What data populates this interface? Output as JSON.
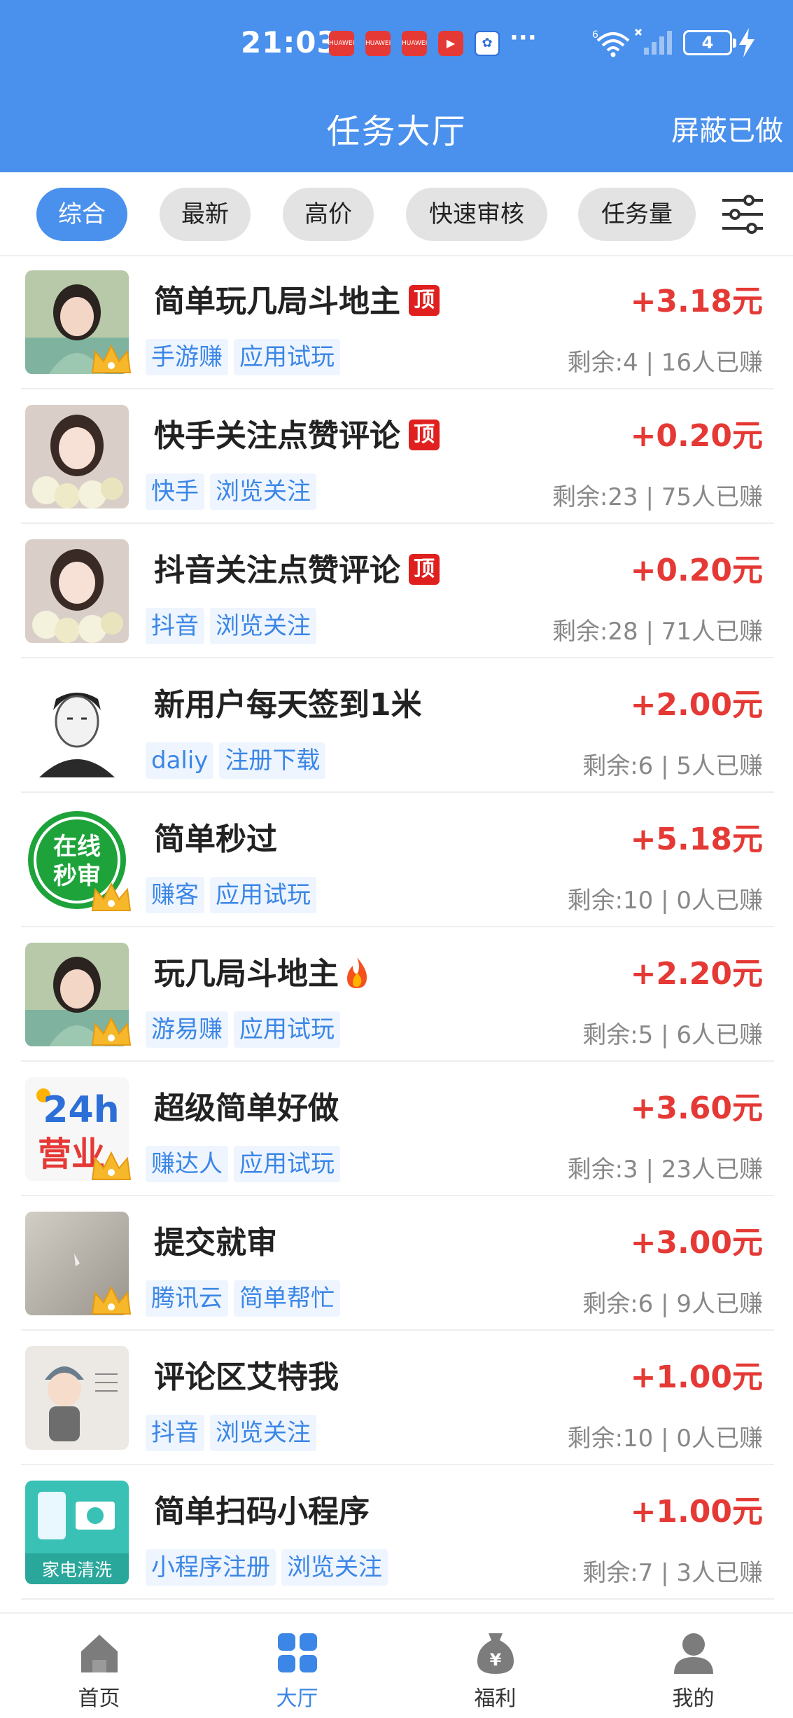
{
  "status_bar": {
    "time": "21:03",
    "network": "6",
    "battery": "4",
    "more": "···"
  },
  "header": {
    "title": "任务大厅",
    "hide_done": "屏蔽已做"
  },
  "filters": [
    {
      "label": "综合",
      "active": true
    },
    {
      "label": "最新",
      "active": false
    },
    {
      "label": "高价",
      "active": false
    },
    {
      "label": "快速审核",
      "active": false
    },
    {
      "label": "任务量",
      "active": false
    }
  ],
  "filter_icon": "sliders-icon",
  "tasks": [
    {
      "title": "简单玩几局斗地主",
      "badge": "顶",
      "reward": "+3.18元",
      "tags": [
        "手游赚",
        "应用试玩"
      ],
      "stats": "剩余:4 | 16人已赚",
      "avatar": "girl-avatar",
      "crown": true
    },
    {
      "title": "快手关注点赞评论",
      "badge": "顶",
      "reward": "+0.20元",
      "tags": [
        "快手",
        "浏览关注"
      ],
      "stats": "剩余:23 | 75人已赚",
      "avatar": "girl-flowers-avatar",
      "crown": false
    },
    {
      "title": "抖音关注点赞评论",
      "badge": "顶",
      "reward": "+0.20元",
      "tags": [
        "抖音",
        "浏览关注"
      ],
      "stats": "剩余:28 | 71人已赚",
      "avatar": "girl-flowers-avatar",
      "crown": false
    },
    {
      "title": "新用户每天签到1米",
      "badge": "",
      "reward": "+2.00元",
      "tags": [
        "daliy",
        "注册下载"
      ],
      "stats": "剩余:6 | 5人已赚",
      "avatar": "man-sketch-avatar",
      "crown": false
    },
    {
      "title": "简单秒过",
      "badge": "",
      "reward": "+5.18元",
      "tags": [
        "赚客",
        "应用试玩"
      ],
      "stats": "剩余:10 | 0人已赚",
      "avatar": "online-audit-logo",
      "avatar_text": [
        "在线",
        "秒审"
      ],
      "crown": true
    },
    {
      "title": "玩几局斗地主",
      "badge": "",
      "fire": true,
      "reward": "+2.20元",
      "tags": [
        "游易赚",
        "应用试玩"
      ],
      "stats": "剩余:5 | 6人已赚",
      "avatar": "girl-avatar",
      "crown": true
    },
    {
      "title": "超级简单好做",
      "badge": "",
      "reward": "+3.60元",
      "tags": [
        "赚达人",
        "应用试玩"
      ],
      "stats": "剩余:3 | 23人已赚",
      "avatar": "24h-logo",
      "avatar_text": [
        "24h",
        "营业"
      ],
      "crown": true
    },
    {
      "title": "提交就审",
      "badge": "",
      "reward": "+3.00元",
      "tags": [
        "腾讯云",
        "简单帮忙"
      ],
      "stats": "剩余:6 | 9人已赚",
      "avatar": "grey-photo-avatar",
      "crown": true
    },
    {
      "title": "评论区艾特我",
      "badge": "",
      "reward": "+1.00元",
      "tags": [
        "抖音",
        "浏览关注"
      ],
      "stats": "剩余:10 | 0人已赚",
      "avatar": "cartoon-boy-avatar",
      "crown": false
    },
    {
      "title": "简单扫码小程序",
      "badge": "",
      "reward": "+1.00元",
      "tags": [
        "小程序注册",
        "浏览关注"
      ],
      "stats": "剩余:7 | 3人已赚",
      "avatar": "appliance-clean-logo",
      "avatar_text": [
        "家电清洗"
      ],
      "crown": false
    }
  ],
  "nav": [
    {
      "label": "首页",
      "icon": "home-icon",
      "active": false
    },
    {
      "label": "大厅",
      "icon": "grid-icon",
      "active": true
    },
    {
      "label": "福利",
      "icon": "money-bag-icon",
      "active": false
    },
    {
      "label": "我的",
      "icon": "user-icon",
      "active": false
    }
  ],
  "colors": {
    "brand_blue": "#4a90ed",
    "reward_red": "#e53935",
    "tag_blue": "#3b86e6",
    "badge_red": "#e0201f"
  }
}
